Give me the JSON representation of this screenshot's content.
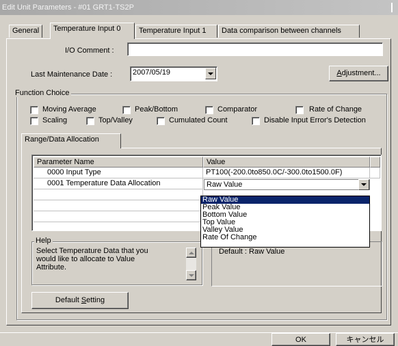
{
  "window": {
    "title": "Edit Unit Parameters - #01 GRT1-TS2P"
  },
  "tabs": [
    {
      "label": "General"
    },
    {
      "label": "Temperature Input 0"
    },
    {
      "label": "Temperature Input 1"
    },
    {
      "label": "Data comparison between channels"
    }
  ],
  "io_comment": {
    "label": "I/O Comment :",
    "value": ""
  },
  "maintenance": {
    "label": "Last Maintenance Date :",
    "value": "2007/05/19"
  },
  "adjustment_button": {
    "pre": "",
    "mnemonic": "A",
    "post": "djustment..."
  },
  "function_choice": {
    "legend": "Function Choice",
    "options": [
      {
        "label": "Moving Average",
        "checked": false
      },
      {
        "label": "Peak/Bottom",
        "checked": false
      },
      {
        "label": "Comparator",
        "checked": false
      },
      {
        "label": "Rate of Change",
        "checked": false
      },
      {
        "label": "Scaling",
        "checked": false
      },
      {
        "label": "Top/Valley",
        "checked": false
      },
      {
        "label": "Cumulated Count",
        "checked": false
      },
      {
        "label": "Disable Input Error's Detection",
        "checked": false
      }
    ]
  },
  "subtab": {
    "label": "Range/Data Allocation"
  },
  "grid": {
    "headers": [
      "Parameter Name",
      "Value"
    ],
    "rows": [
      {
        "name": "0000 Input Type",
        "value": "PT100(-200.0to850.0C/-300.0to1500.0F)"
      },
      {
        "name": "0001 Temperature Data Allocation",
        "value": "Raw Value"
      }
    ]
  },
  "dropdown_options": [
    "Raw Value",
    "Peak Value",
    "Bottom Value",
    "Top Value",
    "Valley Value",
    "Rate Of Change"
  ],
  "help": {
    "legend": "Help",
    "line1": "Select Temperature Data that you",
    "line2": "would like to allocate to Value",
    "line3": "Attribute.",
    "default_text": "Default : Raw Value"
  },
  "default_setting_button": {
    "pre": "Default ",
    "mnemonic": "S",
    "post": "etting"
  },
  "footer": {
    "ok": "OK",
    "cancel": "キャンセル"
  }
}
